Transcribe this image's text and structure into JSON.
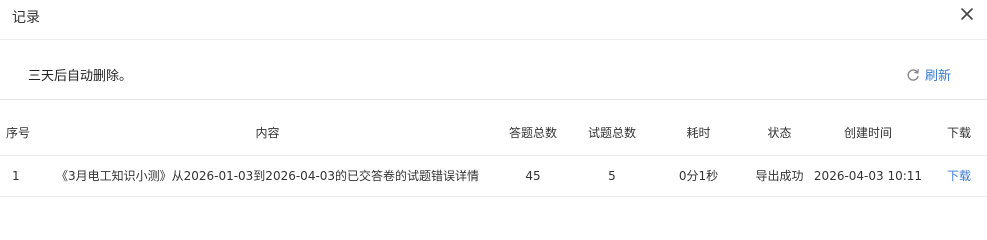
{
  "dialog": {
    "title": "记录",
    "close_icon": "close-icon"
  },
  "notice": {
    "text": "三天后自动删除。",
    "refresh_label": "刷新",
    "refresh_icon": "refresh-icon",
    "accent_color": "#3a7bd5"
  },
  "table": {
    "headers": [
      "序号",
      "内容",
      "答题总数",
      "试题总数",
      "耗时",
      "状态",
      "创建时间",
      "下载"
    ],
    "rows": [
      {
        "index": "1",
        "content": "《3月电工知识小测》从2026-01-03到2026-04-03的已交答卷的试题错误详情",
        "answer_total": "45",
        "question_total": "5",
        "duration": "0分1秒",
        "status": "导出成功",
        "created_at": "2026-04-03 10:11",
        "download": "下载"
      }
    ]
  }
}
